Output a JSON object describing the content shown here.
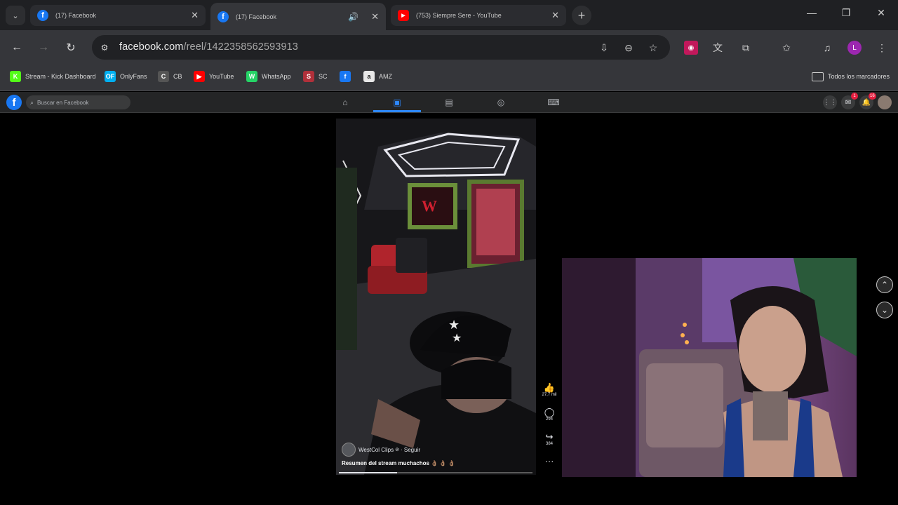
{
  "browser": {
    "tabs": [
      {
        "title": "(17) Facebook",
        "active": false,
        "favicon": "facebook-icon"
      },
      {
        "title": "(17) Facebook",
        "active": true,
        "favicon": "facebook-icon",
        "audio": true
      },
      {
        "title": "(753) Siempre Sere - YouTube",
        "active": false,
        "favicon": "youtube-icon"
      }
    ],
    "url_domain": "facebook.com",
    "url_path": "/reel/1422358562593913",
    "profile_initial": "L",
    "bookmarks": [
      {
        "label": "Stream - Kick Dashboard",
        "icon": "kick-icon",
        "color": "#53fc18",
        "glyph": "K"
      },
      {
        "label": "OnlyFans",
        "icon": "onlyfans-icon",
        "color": "#00aff0",
        "glyph": "OF"
      },
      {
        "label": "CB",
        "icon": "cb-icon",
        "color": "#555",
        "glyph": "C"
      },
      {
        "label": "YouTube",
        "icon": "youtube-icon",
        "color": "#ff0000",
        "glyph": "▶"
      },
      {
        "label": "WhatsApp",
        "icon": "whatsapp-icon",
        "color": "#25d366",
        "glyph": "W"
      },
      {
        "label": "SC",
        "icon": "sc-icon",
        "color": "#b0303a",
        "glyph": "S"
      },
      {
        "label": "",
        "icon": "facebook-icon",
        "color": "#1877f2",
        "glyph": "f"
      },
      {
        "label": "AMZ",
        "icon": "amazon-icon",
        "color": "#e8e8e8",
        "glyph": "a"
      }
    ],
    "all_bookmarks_label": "Todos los marcadores"
  },
  "facebook": {
    "search_placeholder": "Buscar en Facebook",
    "messenger_badge": "1",
    "notifications_badge": "16"
  },
  "reel": {
    "author": "WestCol Clips",
    "follow_label": "· Seguir",
    "caption": "Resumen del stream muchachos 👌🏽 👌🏽 👌🏽",
    "likes": "27,7 mil",
    "comments": "294",
    "shares": "384",
    "more": "···",
    "progress": 0.3
  },
  "colors": {
    "accent": "#2d88ff",
    "facebook_blue": "#1877f2",
    "youtube_red": "#ff0000"
  }
}
